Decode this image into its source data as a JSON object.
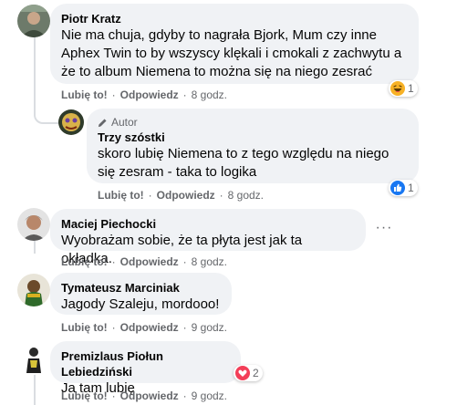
{
  "actions": {
    "like": "Lubię to!",
    "reply": "Odpowiedz",
    "sep": "·"
  },
  "comments": [
    {
      "author": "Piotr Kratz",
      "lines": [
        "Nie ma chuja, gdyby to nagrała Bjork, Mum czy inne",
        "Aphex Twin to by wszyscy klękali i cmokali z zachwytu a",
        "że to album Niemena to można się na niego zesrać"
      ],
      "time": "8 godz.",
      "reaction": {
        "icon": "haha-emoji-icon",
        "count": "1"
      }
    },
    {
      "author_badge": "Autor",
      "author": "Trzy szóstki",
      "lines": [
        "skoro lubię Niemena to z tego względu na niego",
        "się zesram - taka to logika"
      ],
      "time": "8 godz.",
      "reaction": {
        "icon": "like-thumb-icon",
        "count": "1"
      }
    },
    {
      "author": "Maciej Piechocki",
      "lines": [
        "Wyobrażam sobie, że ta płyta jest jak ta okładka."
      ],
      "time": "8 godz.",
      "more_label": "···"
    },
    {
      "author": "Tymateusz Marciniak",
      "lines": [
        "Jagody Szaleju, mordooo!"
      ],
      "time": "9 godz."
    },
    {
      "author": "Premizlaus Piołun Lebiedziński",
      "lines": [
        "Ja tam lubię"
      ],
      "time": "9 godz.",
      "reaction": {
        "icon": "love-heart-icon",
        "count": "2"
      }
    }
  ],
  "colors": {
    "bubble": "#f0f2f5",
    "secondary_text": "#65676b",
    "like_blue": "#1877f2",
    "love_red": "#f33e58",
    "haha_yellow": "#f7b125"
  }
}
